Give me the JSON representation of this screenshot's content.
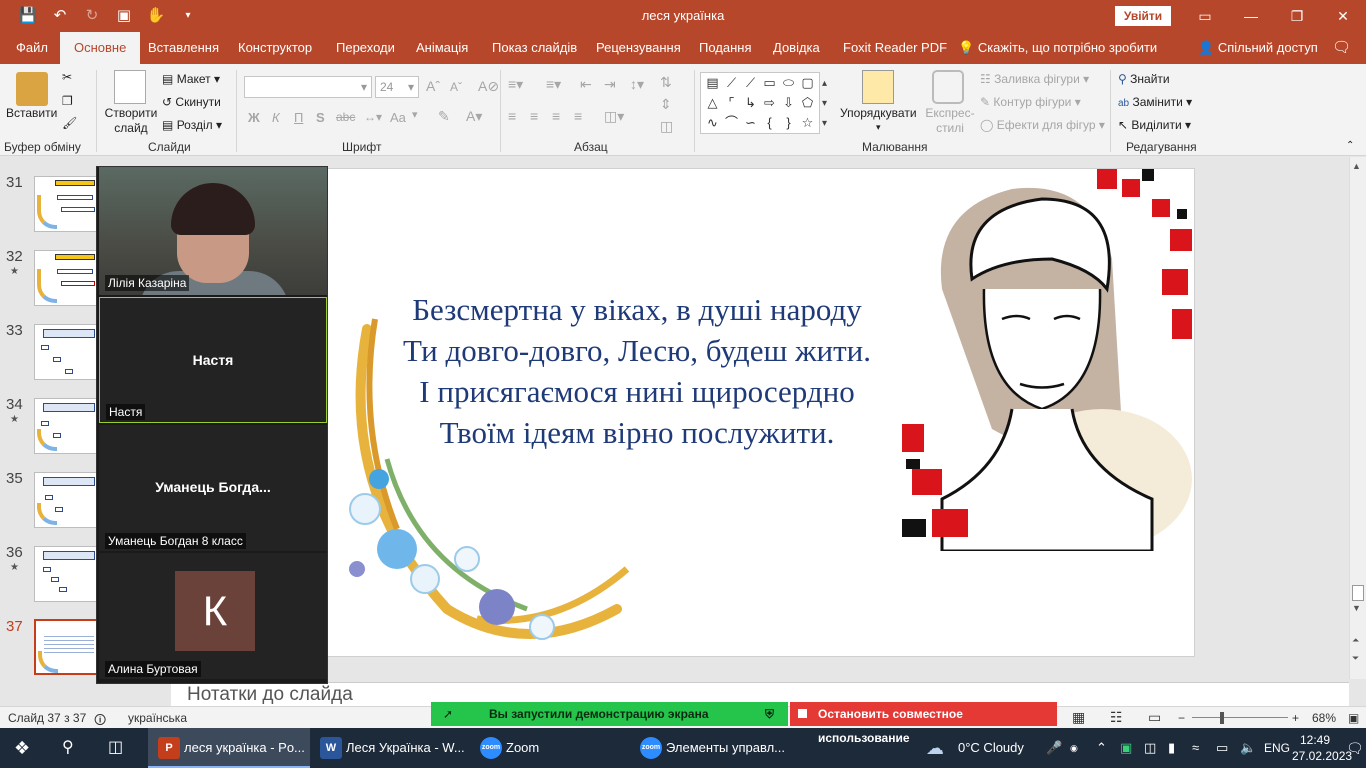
{
  "window": {
    "title": "леся українка",
    "signin": "Увійти"
  },
  "menu": {
    "tabs": [
      "Файл",
      "Основне",
      "Вставлення",
      "Конструктор",
      "Переходи",
      "Анімація",
      "Показ слайдів",
      "Рецензування",
      "Подання",
      "Довідка",
      "Foxit Reader PDF",
      "Скажіть, що потрібно зробити"
    ],
    "share": "Спільний доступ"
  },
  "ribbon": {
    "clipboard": {
      "paste": "Вставити",
      "label": "Буфер обміну"
    },
    "slides": {
      "new_slide": "Створити слайд",
      "layout": "Макет",
      "reset": "Скинути",
      "section": "Розділ",
      "label": "Слайди"
    },
    "font": {
      "size": "24",
      "label": "Шрифт",
      "bold": "Ж",
      "italic": "К",
      "underline": "П",
      "strike": "S",
      "spacing": "abc",
      "case": "Aa"
    },
    "paragraph": {
      "label": "Абзац"
    },
    "drawing": {
      "arrange": "Упорядкувати",
      "quick_styles": "Експрес-стилі",
      "fill": "Заливка фігури",
      "outline": "Контур фігури",
      "effects": "Ефекти для фігур",
      "label": "Малювання"
    },
    "editing": {
      "find": "Знайти",
      "replace": "Замінити",
      "select": "Виділити",
      "label": "Редагування"
    }
  },
  "thumbnails": [
    {
      "num": "31",
      "star": false
    },
    {
      "num": "32",
      "star": true
    },
    {
      "num": "33",
      "star": false
    },
    {
      "num": "34",
      "star": true
    },
    {
      "num": "35",
      "star": false
    },
    {
      "num": "36",
      "star": true
    },
    {
      "num": "37",
      "star": false,
      "current": true
    }
  ],
  "zoom_panel": {
    "participants": [
      {
        "name": "Лілія Казаріна",
        "video": true
      },
      {
        "name": "Настя",
        "center_label": "Настя",
        "speaking": true
      },
      {
        "name": "Уманець Богдан 8 класс",
        "center_label": "Уманець  Богда..."
      },
      {
        "name": "Алина Буртовая",
        "avatar_letter": "К",
        "avatar_color": "#6b4239"
      }
    ]
  },
  "slide": {
    "lines": [
      "Безсмертна у віках, в душі народу",
      "Ти довго-довго, Лесю, будеш жити.",
      "І присягаємося нині щиросердно",
      "Твоїм ідеям вірно послужити."
    ],
    "text_color": "#1f3a78"
  },
  "notes": {
    "placeholder": "Нотатки до слайда"
  },
  "status": {
    "slide_info": "Слайд 37 з 37",
    "language": "українська",
    "sharing": "Вы запустили демонстрацию экрана",
    "stop_sharing": "Остановить совместное использование",
    "zoom": "68%"
  },
  "taskbar": {
    "apps": [
      {
        "label": "леся українка - Po...",
        "icon": "P",
        "color": "#c43e1c",
        "active": true
      },
      {
        "label": "Леся Українка - W...",
        "icon": "W",
        "color": "#2b579a"
      },
      {
        "label": "Zoom",
        "icon": "zoom",
        "color": "#2d8cff"
      },
      {
        "label": "Элементы управл...",
        "icon": "zoom",
        "color": "#2d8cff"
      }
    ],
    "weather": "0°C  Cloudy",
    "lang": "ENG",
    "time": "12:49",
    "date": "27.02.2023"
  },
  "colors": {
    "accent": "#b7472a",
    "share_green": "#25c44b",
    "share_red": "#e53935",
    "taskbar": "#1d2a3a"
  }
}
